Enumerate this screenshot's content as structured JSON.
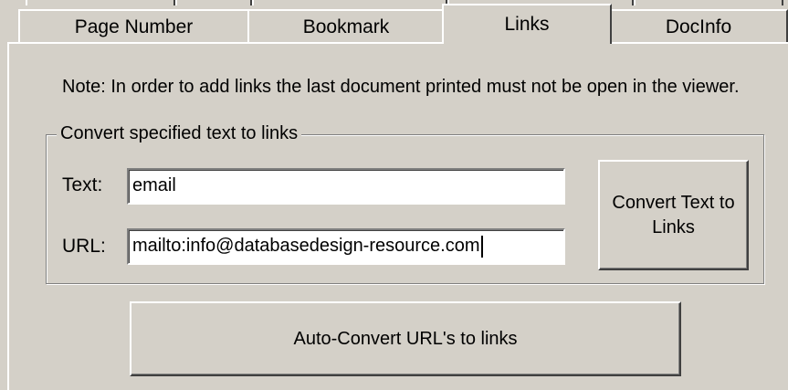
{
  "tabs": {
    "page_number": "Page Number",
    "bookmark": "Bookmark",
    "links": "Links",
    "docinfo": "DocInfo"
  },
  "note": "Note: In order to add links the last document printed must not be open in the viewer.",
  "group": {
    "title": "Convert specified text to links",
    "text_label": "Text:",
    "text_value": "email",
    "url_label": "URL:",
    "url_value": "mailto:info@databasedesign-resource.com",
    "convert_button": "Convert Text to\nLinks"
  },
  "auto_convert_button": "Auto-Convert URL's to links",
  "colors": {
    "face": "#d4d0c8",
    "highlight": "#ffffff",
    "shadow": "#808080",
    "dark_shadow": "#404040"
  }
}
